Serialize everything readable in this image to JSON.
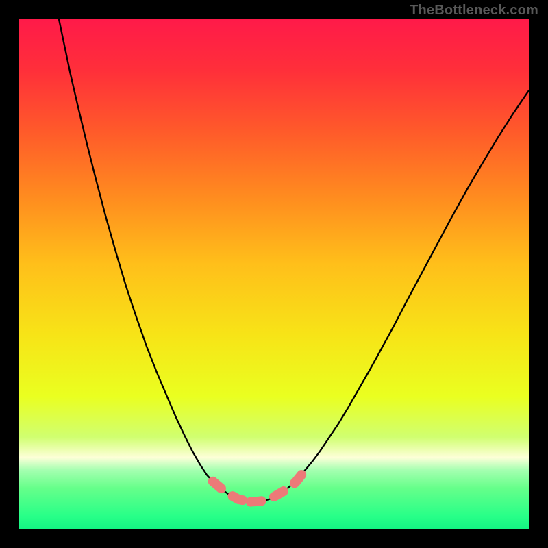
{
  "watermark": "TheBottleneck.com",
  "gradient": {
    "stops": [
      {
        "offset": 0.0,
        "color": "#ff1a49"
      },
      {
        "offset": 0.1,
        "color": "#ff2f3a"
      },
      {
        "offset": 0.22,
        "color": "#ff5a2a"
      },
      {
        "offset": 0.35,
        "color": "#ff8c1f"
      },
      {
        "offset": 0.48,
        "color": "#ffbf1a"
      },
      {
        "offset": 0.62,
        "color": "#f7e417"
      },
      {
        "offset": 0.74,
        "color": "#eaff20"
      },
      {
        "offset": 0.82,
        "color": "#d0ff70"
      },
      {
        "offset": 0.86,
        "color": "#fdffd8"
      },
      {
        "offset": 0.885,
        "color": "#a4ffb0"
      },
      {
        "offset": 0.92,
        "color": "#66ff8a"
      },
      {
        "offset": 0.975,
        "color": "#28ff88"
      },
      {
        "offset": 1.0,
        "color": "#14f583"
      }
    ]
  },
  "curve": {
    "color": "#000000",
    "width": 2.4,
    "points": [
      [
        0.078,
        0.0
      ],
      [
        0.088,
        0.048
      ],
      [
        0.1,
        0.105
      ],
      [
        0.115,
        0.17
      ],
      [
        0.133,
        0.245
      ],
      [
        0.15,
        0.312
      ],
      [
        0.17,
        0.388
      ],
      [
        0.19,
        0.458
      ],
      [
        0.21,
        0.525
      ],
      [
        0.23,
        0.585
      ],
      [
        0.25,
        0.642
      ],
      [
        0.27,
        0.693
      ],
      [
        0.29,
        0.74
      ],
      [
        0.308,
        0.782
      ],
      [
        0.325,
        0.818
      ],
      [
        0.34,
        0.848
      ],
      [
        0.355,
        0.874
      ],
      [
        0.368,
        0.894
      ],
      [
        0.38,
        0.907
      ],
      [
        0.392,
        0.918
      ],
      [
        0.405,
        0.928
      ],
      [
        0.42,
        0.938
      ],
      [
        0.435,
        0.944
      ],
      [
        0.448,
        0.946
      ],
      [
        0.46,
        0.947
      ],
      [
        0.472,
        0.946
      ],
      [
        0.484,
        0.944
      ],
      [
        0.496,
        0.94
      ],
      [
        0.51,
        0.933
      ],
      [
        0.524,
        0.923
      ],
      [
        0.536,
        0.912
      ],
      [
        0.548,
        0.899
      ],
      [
        0.56,
        0.886
      ],
      [
        0.575,
        0.868
      ],
      [
        0.59,
        0.848
      ],
      [
        0.606,
        0.824
      ],
      [
        0.625,
        0.796
      ],
      [
        0.645,
        0.763
      ],
      [
        0.665,
        0.728
      ],
      [
        0.688,
        0.688
      ],
      [
        0.71,
        0.648
      ],
      [
        0.735,
        0.602
      ],
      [
        0.76,
        0.554
      ],
      [
        0.79,
        0.498
      ],
      [
        0.82,
        0.442
      ],
      [
        0.85,
        0.386
      ],
      [
        0.88,
        0.332
      ],
      [
        0.91,
        0.281
      ],
      [
        0.94,
        0.231
      ],
      [
        0.97,
        0.184
      ],
      [
        1.0,
        0.14
      ]
    ]
  },
  "dotted_segments": {
    "color": "#ec7a78",
    "width": 14,
    "dash": [
      16,
      20
    ],
    "cap": "round",
    "segments": [
      {
        "points": [
          [
            0.38,
            0.907
          ],
          [
            0.405,
            0.928
          ],
          [
            0.43,
            0.942
          ],
          [
            0.454,
            0.947
          ]
        ]
      },
      {
        "points": [
          [
            0.454,
            0.947
          ],
          [
            0.47,
            0.946
          ],
          [
            0.486,
            0.944
          ]
        ]
      },
      {
        "points": [
          [
            0.5,
            0.937
          ],
          [
            0.524,
            0.923
          ],
          [
            0.542,
            0.909
          ],
          [
            0.554,
            0.894
          ]
        ]
      }
    ]
  },
  "chart_data": {
    "type": "line",
    "title": "",
    "xlabel": "",
    "ylabel": "",
    "xlim": [
      0,
      1
    ],
    "ylim": [
      0,
      1
    ],
    "grid": false,
    "legend": false,
    "annotations": [
      "TheBottleneck.com"
    ],
    "series": [
      {
        "name": "bottleneck-curve",
        "x": [
          0.078,
          0.088,
          0.1,
          0.115,
          0.133,
          0.15,
          0.17,
          0.19,
          0.21,
          0.23,
          0.25,
          0.27,
          0.29,
          0.308,
          0.325,
          0.34,
          0.355,
          0.368,
          0.38,
          0.392,
          0.405,
          0.42,
          0.435,
          0.448,
          0.46,
          0.472,
          0.484,
          0.496,
          0.51,
          0.524,
          0.536,
          0.548,
          0.56,
          0.575,
          0.59,
          0.606,
          0.625,
          0.645,
          0.665,
          0.688,
          0.71,
          0.735,
          0.76,
          0.79,
          0.82,
          0.85,
          0.88,
          0.91,
          0.94,
          0.97,
          1.0
        ],
        "y": [
          1.0,
          0.952,
          0.895,
          0.83,
          0.755,
          0.688,
          0.612,
          0.542,
          0.475,
          0.415,
          0.358,
          0.307,
          0.26,
          0.218,
          0.182,
          0.152,
          0.126,
          0.106,
          0.093,
          0.082,
          0.072,
          0.062,
          0.056,
          0.054,
          0.053,
          0.054,
          0.056,
          0.06,
          0.067,
          0.077,
          0.088,
          0.101,
          0.114,
          0.132,
          0.152,
          0.176,
          0.204,
          0.237,
          0.272,
          0.312,
          0.352,
          0.398,
          0.446,
          0.502,
          0.558,
          0.614,
          0.668,
          0.719,
          0.769,
          0.816,
          0.86
        ]
      }
    ],
    "highlight_region_x": [
      0.38,
      0.555
    ]
  }
}
